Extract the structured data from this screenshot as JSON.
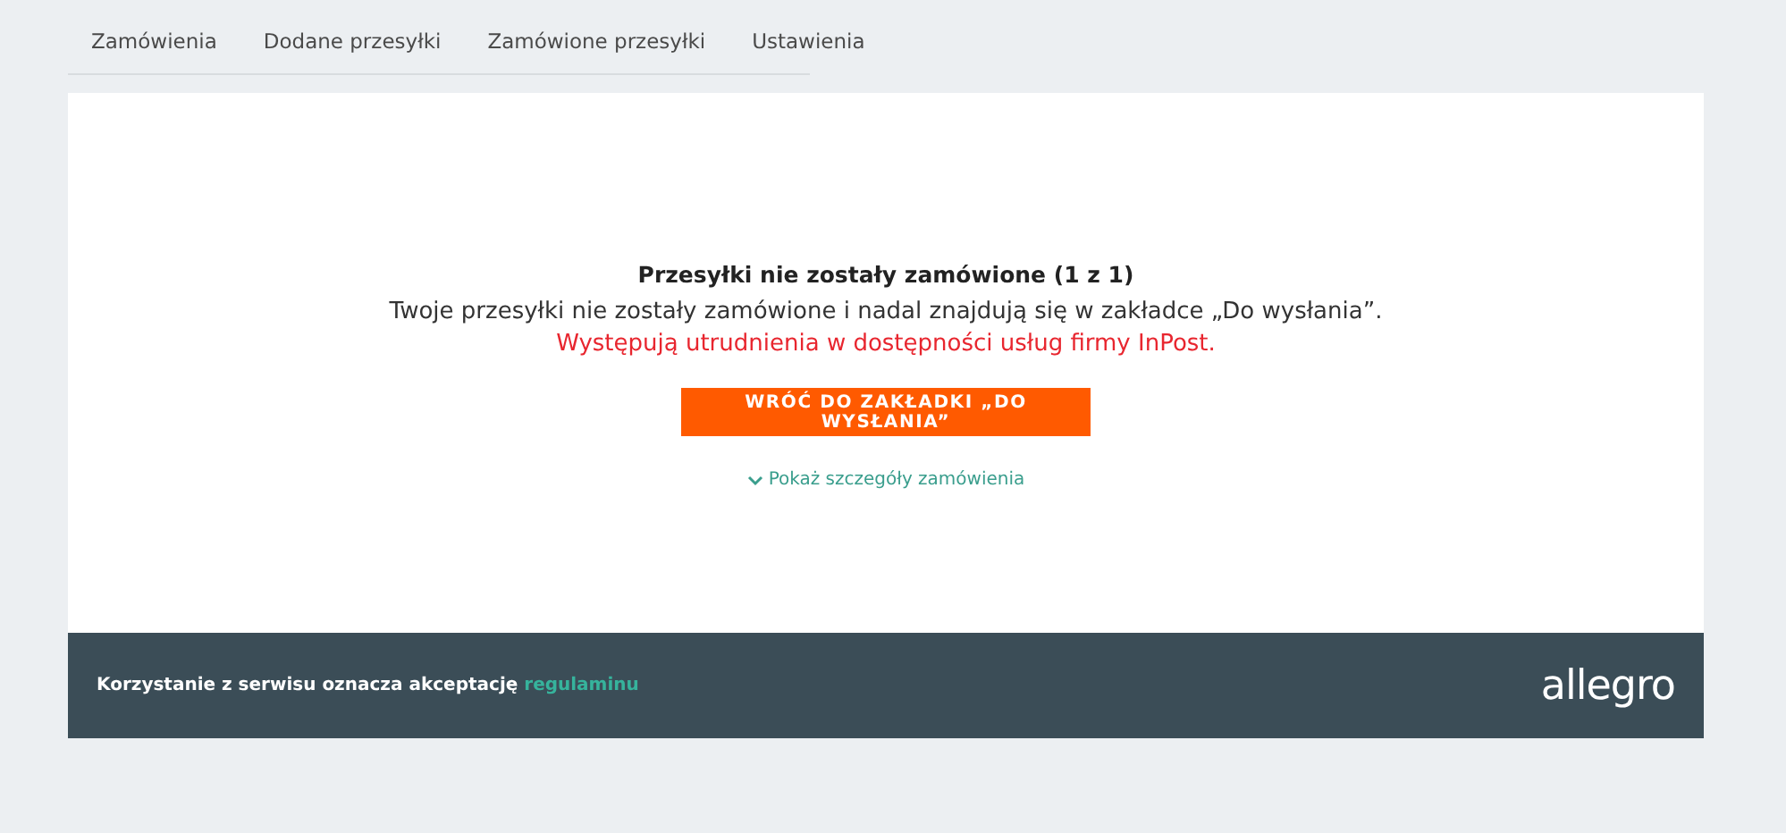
{
  "tabs": [
    {
      "label": "Zamówienia",
      "selected": false
    },
    {
      "label": "Dodane przesyłki",
      "selected": false
    },
    {
      "label": "Zamówione przesyłki",
      "selected": false
    },
    {
      "label": "Ustawienia",
      "selected": false
    }
  ],
  "message": {
    "title": "Przesyłki nie zostały zamówione (1 z 1)",
    "description": "Twoje przesyłki nie zostały zamówione i nadal znajdują się w zakładce „Do wysłania”.",
    "error": "Występują utrudnienia w dostępności usług firmy InPost.",
    "button": "WRÓĆ DO ZAKŁADKI „DO WYSŁANIA”",
    "details_link": "Pokaż szczegóły zamówienia"
  },
  "footer": {
    "text": "Korzystanie z serwisu oznacza akceptację",
    "link": "regulaminu",
    "logo": "allegro"
  }
}
